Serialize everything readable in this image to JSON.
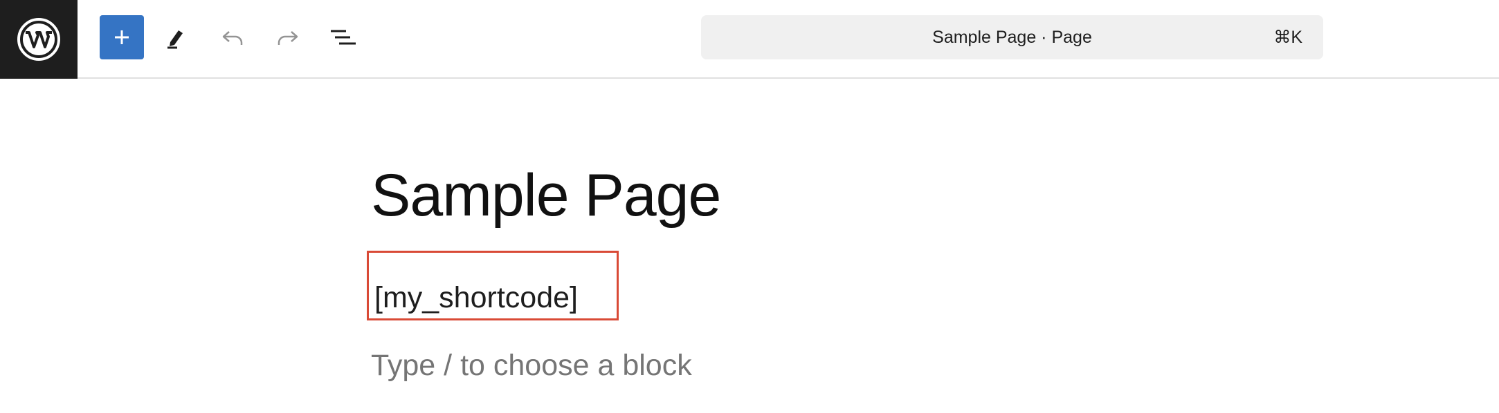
{
  "toolbar": {
    "logo_icon": "wordpress-logo-icon",
    "inserter_icon": "plus-icon",
    "tools_icon": "pencil-icon",
    "undo_icon": "undo-icon",
    "redo_icon": "redo-icon",
    "document_overview_icon": "list-view-icon",
    "accent_color": "#3574c4"
  },
  "command_bar": {
    "title": "Sample Page · Page",
    "shortcut": "⌘K"
  },
  "editor": {
    "page_title": "Sample Page",
    "shortcode_block": "[my_shortcode]",
    "placeholder": "Type / to choose a block",
    "highlight_color": "#d94a36"
  }
}
